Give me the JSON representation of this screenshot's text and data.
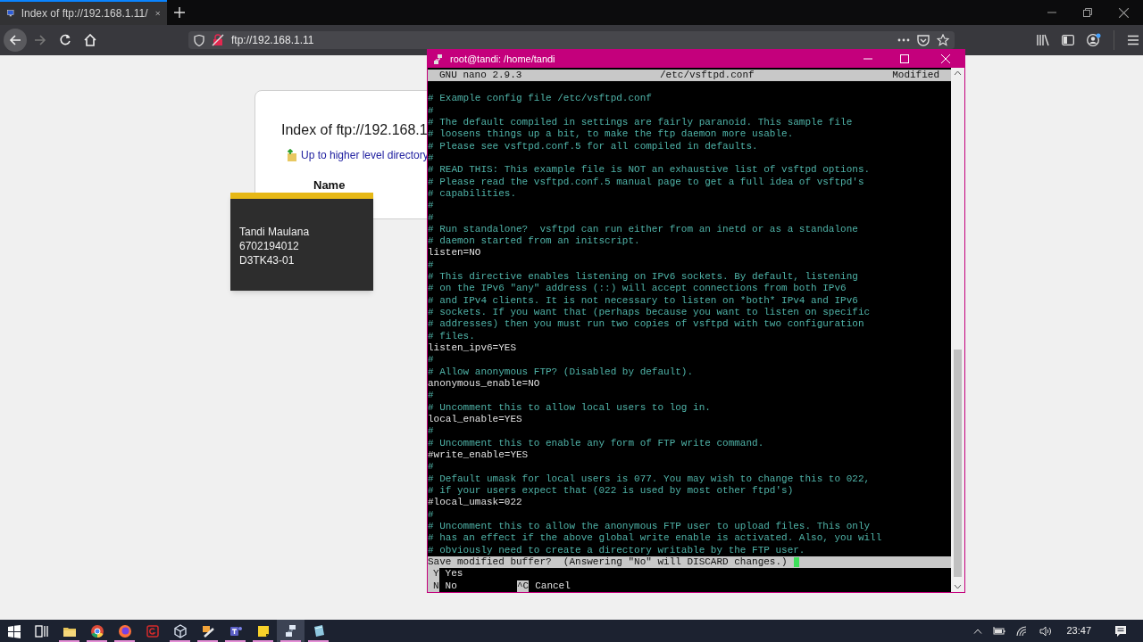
{
  "browser": {
    "tab_title": "Index of ftp://192.168.1.11/",
    "url": "ftp://192.168.1.11",
    "page": {
      "heading": "Index of ftp://192.168.1",
      "parent_link": "Up to higher level directory",
      "column_header": "Name"
    }
  },
  "tooltip": {
    "lines": [
      "Tandi Maulana",
      "6702194012",
      "D3TK43-01"
    ]
  },
  "terminal": {
    "title": "root@tandi: /home/tandi",
    "editor": {
      "version": "GNU nano 2.9.3",
      "filename": "/etc/vsftpd.conf",
      "status": "Modified"
    },
    "lines": [
      {
        "text": "# Example config file /etc/vsftpd.conf",
        "kind": "comment"
      },
      {
        "text": "#",
        "kind": "comment"
      },
      {
        "text": "# The default compiled in settings are fairly paranoid. This sample file",
        "kind": "comment"
      },
      {
        "text": "# loosens things up a bit, to make the ftp daemon more usable.",
        "kind": "comment"
      },
      {
        "text": "# Please see vsftpd.conf.5 for all compiled in defaults.",
        "kind": "comment"
      },
      {
        "text": "#",
        "kind": "comment"
      },
      {
        "text": "# READ THIS: This example file is NOT an exhaustive list of vsftpd options.",
        "kind": "comment"
      },
      {
        "text": "# Please read the vsftpd.conf.5 manual page to get a full idea of vsftpd's",
        "kind": "comment"
      },
      {
        "text": "# capabilities.",
        "kind": "comment"
      },
      {
        "text": "#",
        "kind": "comment"
      },
      {
        "text": "#",
        "kind": "comment"
      },
      {
        "text": "# Run standalone?  vsftpd can run either from an inetd or as a standalone",
        "kind": "comment"
      },
      {
        "text": "# daemon started from an initscript.",
        "kind": "comment"
      },
      {
        "text": "listen=NO",
        "kind": "setting"
      },
      {
        "text": "#",
        "kind": "comment"
      },
      {
        "text": "# This directive enables listening on IPv6 sockets. By default, listening",
        "kind": "comment"
      },
      {
        "text": "# on the IPv6 \"any\" address (::) will accept connections from both IPv6",
        "kind": "comment"
      },
      {
        "text": "# and IPv4 clients. It is not necessary to listen on *both* IPv4 and IPv6",
        "kind": "comment"
      },
      {
        "text": "# sockets. If you want that (perhaps because you want to listen on specific",
        "kind": "comment"
      },
      {
        "text": "# addresses) then you must run two copies of vsftpd with two configuration",
        "kind": "comment"
      },
      {
        "text": "# files.",
        "kind": "comment"
      },
      {
        "text": "listen_ipv6=YES",
        "kind": "setting"
      },
      {
        "text": "#",
        "kind": "comment"
      },
      {
        "text": "# Allow anonymous FTP? (Disabled by default).",
        "kind": "comment"
      },
      {
        "text": "anonymous_enable=NO",
        "kind": "setting"
      },
      {
        "text": "#",
        "kind": "comment"
      },
      {
        "text": "# Uncomment this to allow local users to log in.",
        "kind": "comment"
      },
      {
        "text": "local_enable=YES",
        "kind": "setting"
      },
      {
        "text": "#",
        "kind": "comment"
      },
      {
        "text": "# Uncomment this to enable any form of FTP write command.",
        "kind": "comment"
      },
      {
        "text": "#write_enable=YES",
        "kind": "setting"
      },
      {
        "text": "#",
        "kind": "comment"
      },
      {
        "text": "# Default umask for local users is 077. You may wish to change this to 022,",
        "kind": "comment"
      },
      {
        "text": "# if your users expect that (022 is used by most other ftpd's)",
        "kind": "comment"
      },
      {
        "text": "#local_umask=022",
        "kind": "setting"
      },
      {
        "text": "#",
        "kind": "comment"
      },
      {
        "text": "# Uncomment this to allow the anonymous FTP user to upload files. This only",
        "kind": "comment"
      },
      {
        "text": "# has an effect if the above global write enable is activated. Also, you will",
        "kind": "comment"
      },
      {
        "text": "# obviously need to create a directory writable by the FTP user.",
        "kind": "comment"
      }
    ],
    "prompt": "Save modified buffer?  (Answering \"No\" will DISCARD changes.)",
    "options": [
      {
        "key": "Y",
        "label": "Yes"
      },
      {
        "key": "N",
        "label": "No"
      },
      {
        "key": "^C",
        "label": "Cancel"
      }
    ]
  },
  "taskbar": {
    "apps": [
      {
        "kind": "start",
        "running": false,
        "selected": false
      },
      {
        "kind": "taskview",
        "running": false,
        "selected": false
      },
      {
        "kind": "folder",
        "running": true,
        "selected": false
      },
      {
        "kind": "chrome",
        "running": true,
        "selected": false
      },
      {
        "kind": "firefox",
        "running": true,
        "selected": false
      },
      {
        "kind": "redapp",
        "running": false,
        "selected": false
      },
      {
        "kind": "cube",
        "running": true,
        "selected": false
      },
      {
        "kind": "tool",
        "running": true,
        "selected": false
      },
      {
        "kind": "teams",
        "running": true,
        "selected": false
      },
      {
        "kind": "notes",
        "running": true,
        "selected": false
      },
      {
        "kind": "network",
        "running": true,
        "selected": true
      },
      {
        "kind": "disk",
        "running": true,
        "selected": false
      }
    ],
    "clock": "23:47"
  }
}
